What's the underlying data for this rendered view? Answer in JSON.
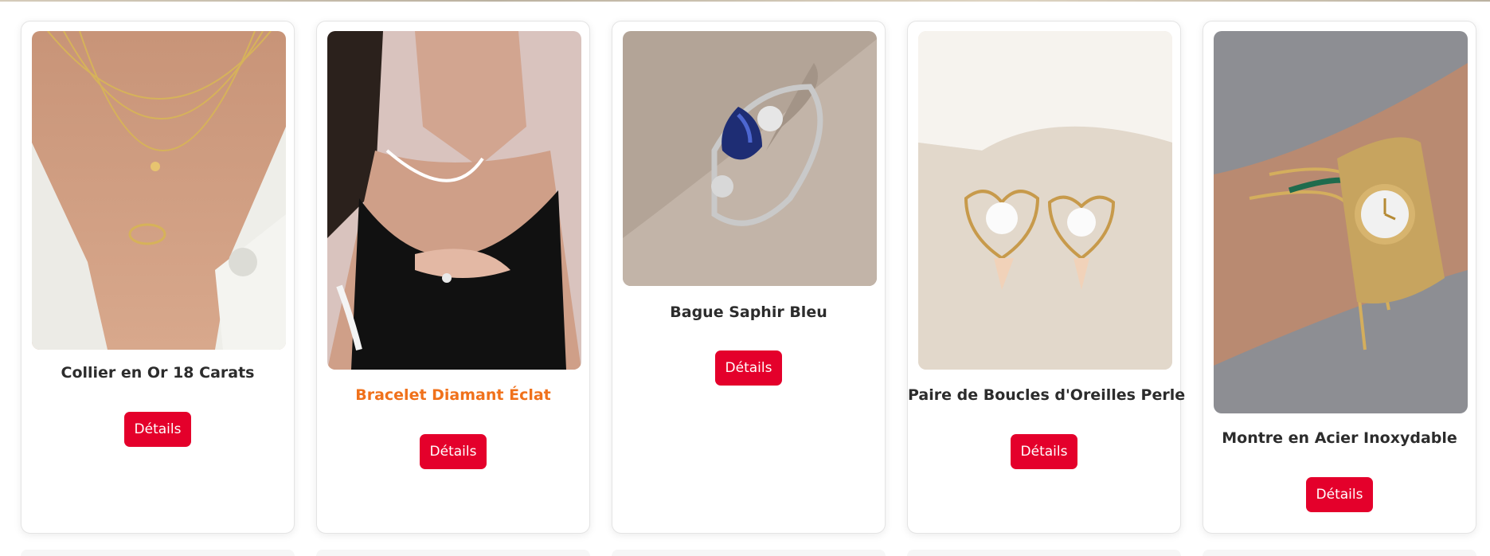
{
  "products": [
    {
      "name": "Collier en Or 18 Carats",
      "button_label": "Détails",
      "image": "gold-necklace-photo"
    },
    {
      "name": "Bracelet Diamant Éclat",
      "button_label": "Détails",
      "image": "diamond-bracelet-photo"
    },
    {
      "name": "Bague Saphir Bleu",
      "button_label": "Détails",
      "image": "sapphire-ring-photo"
    },
    {
      "name": "Paire de Boucles d'Oreilles Perle",
      "button_label": "Détails",
      "image": "pearl-earrings-photo"
    },
    {
      "name": "Montre en Acier Inoxydable",
      "button_label": "Détails",
      "image": "steel-watch-photo"
    }
  ],
  "colors": {
    "button": "#e4002b",
    "highlighted_title": "#f0711b",
    "title": "#2c2c2c"
  }
}
